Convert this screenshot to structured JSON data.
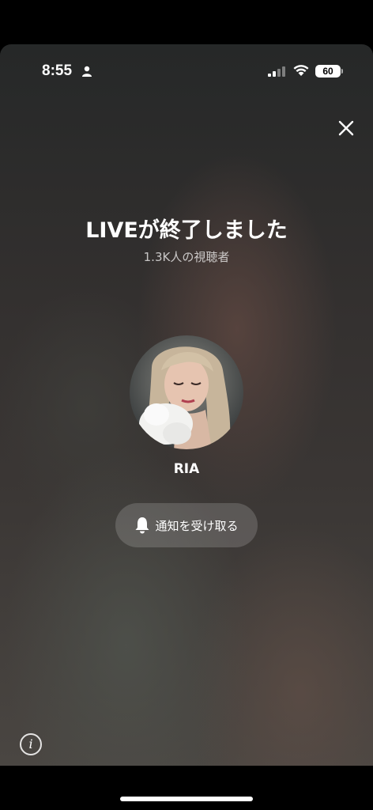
{
  "status_bar": {
    "time": "8:55",
    "battery_level": "60",
    "icons": [
      "person-icon",
      "cellular-signal-icon",
      "wifi-icon",
      "battery-icon"
    ]
  },
  "live_ended": {
    "title": "LIVEが終了しました",
    "viewers_text": "1.3K人の視聴者"
  },
  "profile": {
    "username": "RIA"
  },
  "notify_button": {
    "label": "通知を受け取る",
    "icon": "bell-icon"
  },
  "info_button": {
    "glyph": "i"
  },
  "colors": {
    "text": "#ffffff",
    "button_bg": "rgba(255,255,255,0.16)"
  }
}
